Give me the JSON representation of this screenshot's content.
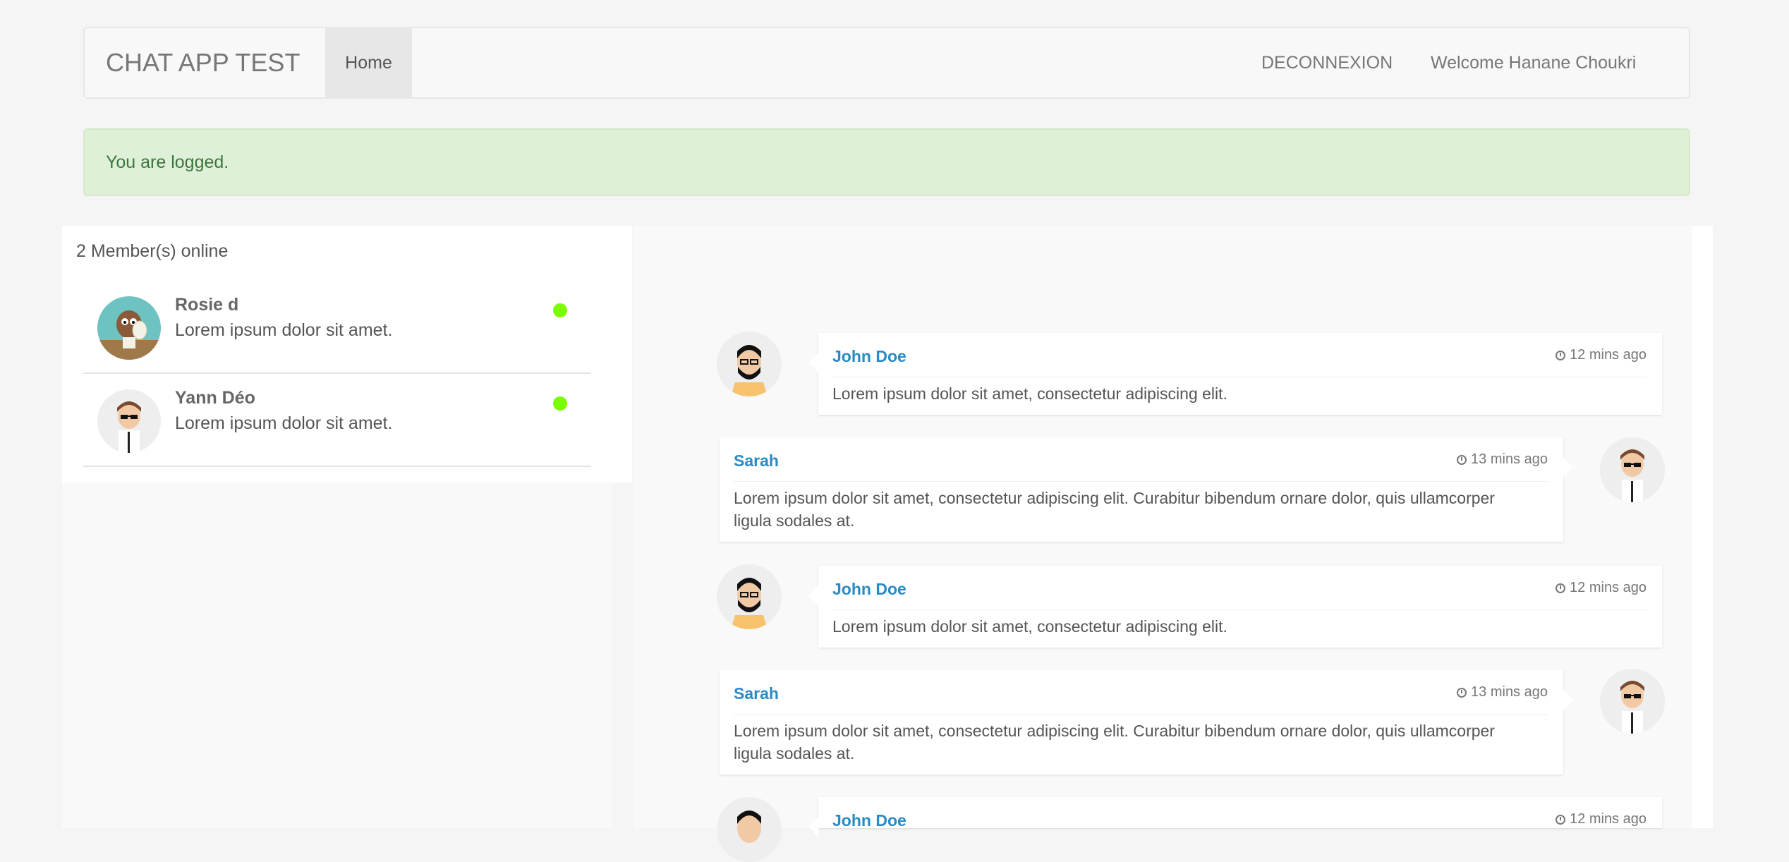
{
  "navbar": {
    "brand": "CHAT APP TEST",
    "home": "Home",
    "logout": "DECONNEXION",
    "welcome": "Welcome Hanane Choukri"
  },
  "alert": {
    "text": "You are logged."
  },
  "members": {
    "title": "2 Member(s) online",
    "items": [
      {
        "name": "Rosie d",
        "message": "Lorem ipsum dolor sit amet.",
        "status": "online",
        "status_color": "#7cfc00"
      },
      {
        "name": "Yann Déo",
        "message": "Lorem ipsum dolor sit amet.",
        "status": "online",
        "status_color": "#7cfc00"
      }
    ]
  },
  "chat": {
    "messages": [
      {
        "author": "John Doe",
        "time": "12 mins ago",
        "text": "Lorem ipsum dolor sit amet, consectetur adipiscing elit.",
        "side": "left"
      },
      {
        "author": "Sarah",
        "time": "13 mins ago",
        "text": "Lorem ipsum dolor sit amet, consectetur adipiscing elit. Curabitur bibendum ornare dolor, quis ullamcorper ligula sodales at.",
        "side": "right"
      },
      {
        "author": "John Doe",
        "time": "12 mins ago",
        "text": "Lorem ipsum dolor sit amet, consectetur adipiscing elit.",
        "side": "left"
      },
      {
        "author": "Sarah",
        "time": "13 mins ago",
        "text": "Lorem ipsum dolor sit amet, consectetur adipiscing elit. Curabitur bibendum ornare dolor, quis ullamcorper ligula sodales at.",
        "side": "right"
      },
      {
        "author": "John Doe",
        "time": "12 mins ago",
        "text": "",
        "side": "left"
      }
    ]
  },
  "colors": {
    "link": "#2a8ac4",
    "alert_bg": "#dff0d8",
    "alert_text": "#3c763d"
  }
}
